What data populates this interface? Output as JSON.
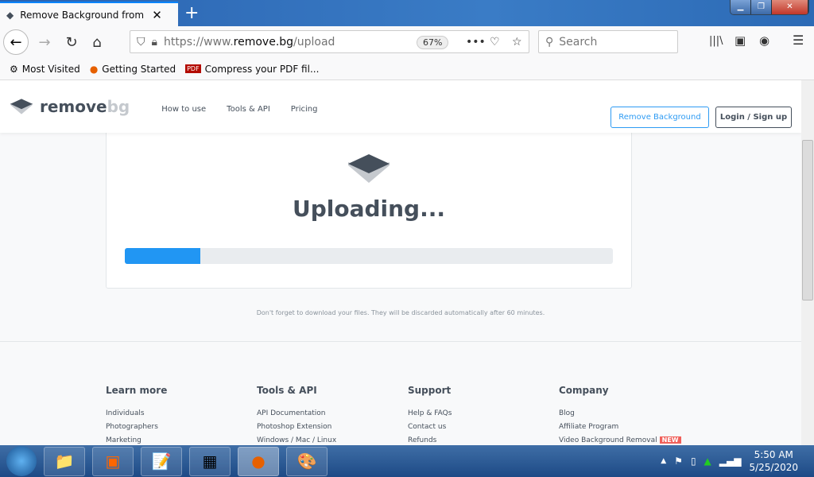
{
  "browser": {
    "tab_title": "Remove Background from Image",
    "url_prefix": "https://www.",
    "url_host": "remove.bg",
    "url_path": "/upload",
    "zoom": "67%",
    "search_placeholder": "Search",
    "bookmarks": [
      "Most Visited",
      "Getting Started",
      "Compress your PDF fil..."
    ]
  },
  "site": {
    "logo_main": "remove",
    "logo_bg": "bg",
    "nav": [
      "How to use",
      "Tools & API",
      "Pricing"
    ],
    "remove_bg_button": "Remove Background",
    "login_button": "Login / Sign up",
    "status": "Uploading...",
    "progress_percent": 15.5,
    "accent": "#2196f3",
    "note": "Don't forget to download your files. They will be discarded automatically after 60 minutes.",
    "footer": [
      {
        "title": "Learn more",
        "links": [
          "Individuals",
          "Photographers",
          "Marketing"
        ]
      },
      {
        "title": "Tools & API",
        "links": [
          "API Documentation",
          "Photoshop Extension",
          "Windows / Mac / Linux"
        ]
      },
      {
        "title": "Support",
        "links": [
          "Help & FAQs",
          "Contact us",
          "Refunds"
        ]
      },
      {
        "title": "Company",
        "links": [
          "Blog",
          "Affiliate Program",
          "Video Background Removal"
        ],
        "badge": "NEW"
      }
    ]
  },
  "taskbar": {
    "time": "5:50 AM",
    "date": "5/25/2020"
  }
}
